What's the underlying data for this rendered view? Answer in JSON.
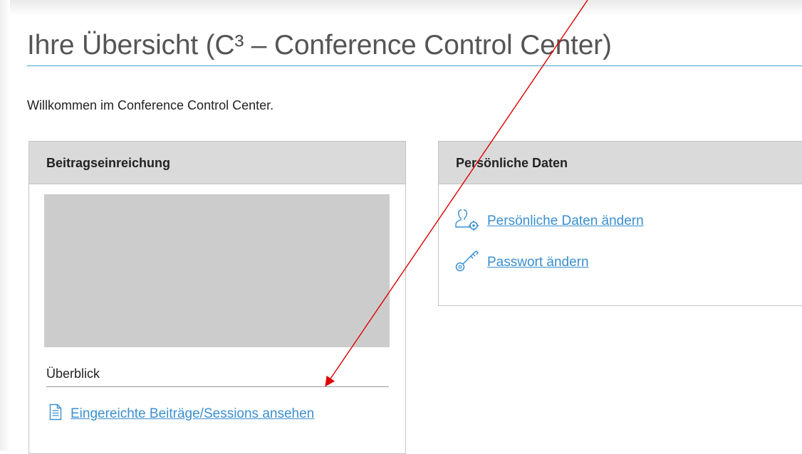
{
  "header": {
    "title": "Ihre Übersicht (C³ – Conference Control Center)",
    "welcome": "Willkommen im Conference Control Center."
  },
  "submission_panel": {
    "heading": "Beitragseinreichung",
    "section_label": "Überblick",
    "submissions_link": "Eingereichte Beiträge/Sessions ansehen",
    "submissions_icon": "document-icon"
  },
  "personal_panel": {
    "heading": "Persönliche Daten",
    "edit_personal_link": "Persönliche Daten ändern",
    "edit_personal_icon": "user-settings-icon",
    "change_password_link": "Passwort ändern",
    "change_password_icon": "key-icon"
  },
  "colors": {
    "link": "#3a8fd0",
    "accent_rule": "#4aa3c9",
    "panel_header_bg": "#dadada",
    "annotation_arrow": "#e00000"
  }
}
